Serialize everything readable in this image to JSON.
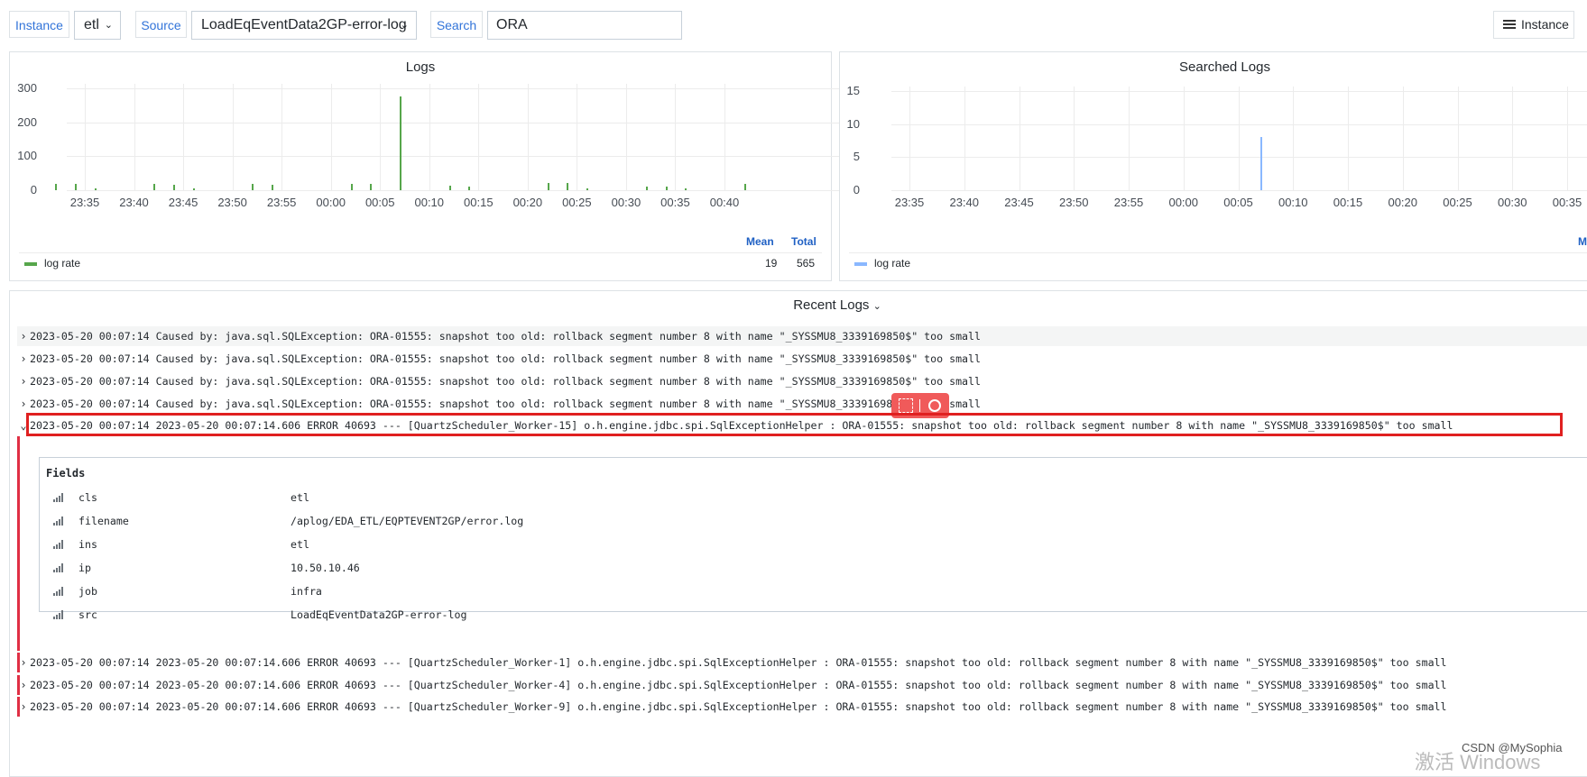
{
  "toolbar": {
    "instance_label": "Instance",
    "instance_value": "etl",
    "source_label": "Source",
    "source_value": "LoadEqEventData2GP-error-log",
    "search_label": "Search",
    "search_value": "ORA",
    "instance_button": "Instance"
  },
  "chart_data": [
    {
      "type": "bar",
      "title": "Logs",
      "x_ticks": [
        "23:35",
        "23:40",
        "23:45",
        "23:50",
        "23:55",
        "00:00",
        "00:05",
        "00:10",
        "00:15",
        "00:20",
        "00:25",
        "00:30",
        "00:35",
        "00:40"
      ],
      "y_ticks": [
        "300",
        "200",
        "100",
        "0"
      ],
      "ylim": [
        0,
        300
      ],
      "series": [
        {
          "name": "log rate",
          "color": "#56a64b",
          "points": [
            {
              "x": "23:32",
              "y": 19
            },
            {
              "x": "23:34",
              "y": 18
            },
            {
              "x": "23:36",
              "y": 5
            },
            {
              "x": "23:42",
              "y": 18
            },
            {
              "x": "23:44",
              "y": 17
            },
            {
              "x": "23:46",
              "y": 6
            },
            {
              "x": "23:52",
              "y": 18
            },
            {
              "x": "23:54",
              "y": 17
            },
            {
              "x": "00:02",
              "y": 19
            },
            {
              "x": "00:04",
              "y": 18
            },
            {
              "x": "00:07",
              "y": 277
            },
            {
              "x": "00:12",
              "y": 12
            },
            {
              "x": "00:14",
              "y": 10
            },
            {
              "x": "00:22",
              "y": 22
            },
            {
              "x": "00:24",
              "y": 21
            },
            {
              "x": "00:26",
              "y": 5
            },
            {
              "x": "00:32",
              "y": 11
            },
            {
              "x": "00:34",
              "y": 10
            },
            {
              "x": "00:36",
              "y": 5
            },
            {
              "x": "00:42",
              "y": 18
            }
          ]
        }
      ],
      "legend": {
        "label": "log rate",
        "mean_header": "Mean",
        "total_header": "Total",
        "mean": "19",
        "total": "565"
      }
    },
    {
      "type": "bar",
      "title": "Searched Logs",
      "x_ticks": [
        "23:35",
        "23:40",
        "23:45",
        "23:50",
        "23:55",
        "00:00",
        "00:05",
        "00:10",
        "00:15",
        "00:20",
        "00:25",
        "00:30",
        "00:35"
      ],
      "y_ticks": [
        "15",
        "10",
        "5",
        "0"
      ],
      "ylim": [
        0,
        15
      ],
      "series": [
        {
          "name": "log rate",
          "color": "#8ab8ff",
          "points": [
            {
              "x": "00:07",
              "y": 8
            }
          ]
        }
      ],
      "legend": {
        "label": "log rate",
        "mean_header": "M"
      }
    }
  ],
  "recent_logs": {
    "title": "Recent Logs",
    "rows": [
      "2023-05-20 00:07:14 Caused by: java.sql.SQLException: ORA-01555: snapshot too old: rollback segment number 8 with name \"_SYSSMU8_3339169850$\" too small",
      "2023-05-20 00:07:14 Caused by: java.sql.SQLException: ORA-01555: snapshot too old: rollback segment number 8 with name \"_SYSSMU8_3339169850$\" too small",
      "2023-05-20 00:07:14 Caused by: java.sql.SQLException: ORA-01555: snapshot too old: rollback segment number 8 with name \"_SYSSMU8_3339169850$\" too small",
      "2023-05-20 00:07:14 Caused by: java.sql.SQLException: ORA-01555: snapshot too old: rollback segment number 8 with name \"_SYSSMU8_3339169850$\" too small",
      "2023-05-20 00:07:14 2023-05-20 00:07:14.606 ERROR 40693 --- [QuartzScheduler_Worker-15] o.h.engine.jdbc.spi.SqlExceptionHelper   : ORA-01555: snapshot too old: rollback segment number 8 with name \"_SYSSMU8_3339169850$\" too small"
    ],
    "fields_title": "Fields",
    "fields": [
      {
        "key": "cls",
        "value": "etl"
      },
      {
        "key": "filename",
        "value": "/aplog/EDA_ETL/EQPTEVENT2GP/error.log"
      },
      {
        "key": "ins",
        "value": "etl"
      },
      {
        "key": "ip",
        "value": "10.50.10.46"
      },
      {
        "key": "job",
        "value": "infra"
      },
      {
        "key": "src",
        "value": "LoadEqEventData2GP-error-log"
      }
    ],
    "rows_after": [
      "2023-05-20 00:07:14 2023-05-20 00:07:14.606 ERROR 40693 --- [QuartzScheduler_Worker-1] o.h.engine.jdbc.spi.SqlExceptionHelper   : ORA-01555: snapshot too old: rollback segment number 8 with name \"_SYSSMU8_3339169850$\" too small",
      "2023-05-20 00:07:14 2023-05-20 00:07:14.606 ERROR 40693 --- [QuartzScheduler_Worker-4] o.h.engine.jdbc.spi.SqlExceptionHelper   : ORA-01555: snapshot too old: rollback segment number 8 with name \"_SYSSMU8_3339169850$\" too small",
      "2023-05-20 00:07:14 2023-05-20 00:07:14.606 ERROR 40693 --- [QuartzScheduler_Worker-9] o.h.engine.jdbc.spi.SqlExceptionHelper   : ORA-01555: snapshot too old: rollback segment number 8 with name \"_SYSSMU8_3339169850$\" too small"
    ]
  },
  "watermark": "CSDN @MySophia",
  "windows_activation": "激活 Windows",
  "icons": [
    "chevron-down-icon",
    "hamburger-icon",
    "expand-caret-icon",
    "signal-bars-icon",
    "text-select-icon",
    "search-icon"
  ],
  "colors": {
    "accent": "#3274d9",
    "series_logs": "#56a64b",
    "series_searched": "#8ab8ff",
    "highlight": "#e02f44"
  }
}
